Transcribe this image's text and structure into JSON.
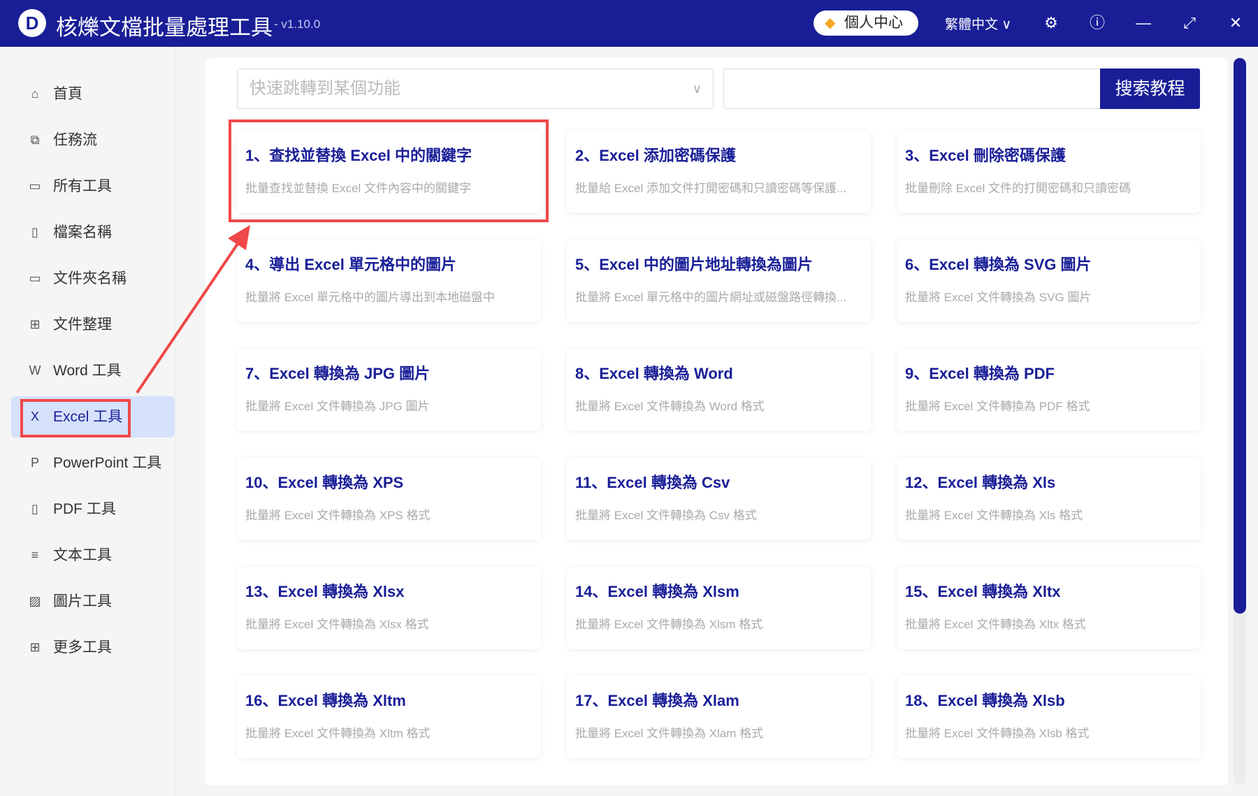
{
  "app": {
    "logo": "D",
    "title": "核爍文檔批量處理工具",
    "version": "- v1.10.0",
    "vip_label": "個人中心",
    "language": "繁體中文",
    "language_chevron": "∨"
  },
  "sidebar": {
    "items": [
      {
        "label": "首頁",
        "icon": "⌂"
      },
      {
        "label": "任務流",
        "icon": "⧉"
      },
      {
        "label": "所有工具",
        "icon": "▭"
      },
      {
        "label": "檔案名稱",
        "icon": "▯"
      },
      {
        "label": "文件夾名稱",
        "icon": "▭"
      },
      {
        "label": "文件整理",
        "icon": "⊞"
      },
      {
        "label": "Word 工具",
        "icon": "W"
      },
      {
        "label": "Excel 工具",
        "icon": "X"
      },
      {
        "label": "PowerPoint 工具",
        "icon": "P"
      },
      {
        "label": "PDF 工具",
        "icon": "▯"
      },
      {
        "label": "文本工具",
        "icon": "≡"
      },
      {
        "label": "圖片工具",
        "icon": "▨"
      },
      {
        "label": "更多工具",
        "icon": "⊞"
      }
    ],
    "active_index": 7
  },
  "search": {
    "dropdown_placeholder": "快速跳轉到某個功能",
    "input_value": "",
    "button_label": "搜索教程"
  },
  "colors": {
    "brand": "#191e97",
    "highlight": "#f04848",
    "active_bg": "#d6e2fb"
  },
  "cards": [
    {
      "title": "1、查找並替換 Excel 中的關鍵字",
      "desc": "批量查找並替換 Excel 文件內容中的關鍵字"
    },
    {
      "title": "2、Excel 添加密碼保護",
      "desc": "批量給 Excel 添加文件打開密碼和只讀密碼等保護..."
    },
    {
      "title": "3、Excel 刪除密碼保護",
      "desc": "批量刪除 Excel 文件的打開密碼和只讀密碼"
    },
    {
      "title": "4、導出 Excel 單元格中的圖片",
      "desc": "批量將 Excel 單元格中的圖片導出到本地磁盤中"
    },
    {
      "title": "5、Excel 中的圖片地址轉換為圖片",
      "desc": "批量將 Excel 單元格中的圖片網址或磁盤路徑轉換..."
    },
    {
      "title": "6、Excel 轉換為 SVG 圖片",
      "desc": "批量將 Excel 文件轉換為 SVG 圖片"
    },
    {
      "title": "7、Excel 轉換為 JPG 圖片",
      "desc": "批量將 Excel 文件轉換為 JPG 圖片"
    },
    {
      "title": "8、Excel 轉換為 Word",
      "desc": "批量將 Excel 文件轉換為 Word 格式"
    },
    {
      "title": "9、Excel 轉換為 PDF",
      "desc": "批量將 Excel 文件轉換為 PDF 格式"
    },
    {
      "title": "10、Excel 轉換為 XPS",
      "desc": "批量將 Excel 文件轉換為 XPS 格式"
    },
    {
      "title": "11、Excel 轉換為 Csv",
      "desc": "批量將 Excel 文件轉換為 Csv 格式"
    },
    {
      "title": "12、Excel 轉換為 Xls",
      "desc": "批量將 Excel 文件轉換為 Xls 格式"
    },
    {
      "title": "13、Excel 轉換為 Xlsx",
      "desc": "批量將 Excel 文件轉換為 Xlsx 格式"
    },
    {
      "title": "14、Excel 轉換為 Xlsm",
      "desc": "批量將 Excel 文件轉換為 Xlsm 格式"
    },
    {
      "title": "15、Excel 轉換為 Xltx",
      "desc": "批量將 Excel 文件轉換為 Xltx 格式"
    },
    {
      "title": "16、Excel 轉換為 Xltm",
      "desc": "批量將 Excel 文件轉換為 Xltm 格式"
    },
    {
      "title": "17、Excel 轉換為 Xlam",
      "desc": "批量將 Excel 文件轉換為 Xlam 格式"
    },
    {
      "title": "18、Excel 轉換為 Xlsb",
      "desc": "批量將 Excel 文件轉換為 Xlsb 格式"
    }
  ]
}
